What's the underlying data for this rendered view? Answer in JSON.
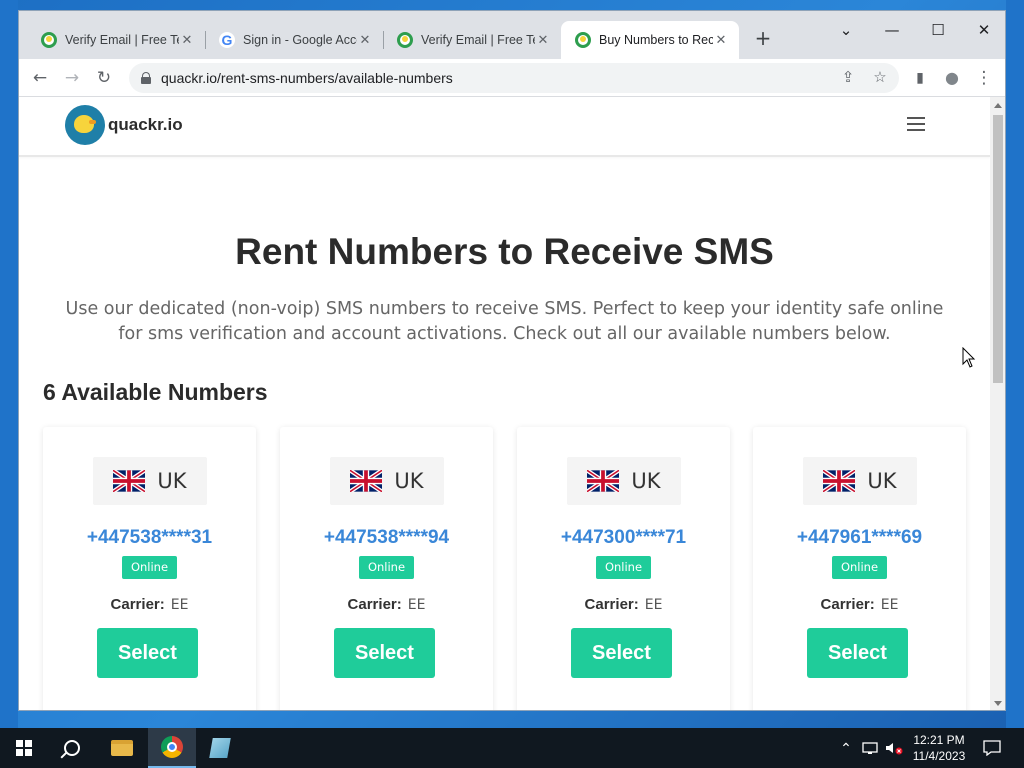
{
  "browser": {
    "tabs": [
      {
        "title": "Verify Email | Free Temporary",
        "favicon": "duck-favicon",
        "active": false
      },
      {
        "title": "Sign in - Google Accounts",
        "favicon": "google-favicon",
        "active": false
      },
      {
        "title": "Verify Email | Free Temporary",
        "favicon": "duck-favicon",
        "active": false
      },
      {
        "title": "Buy Numbers to Receive SMS",
        "favicon": "duck-favicon",
        "active": true
      }
    ],
    "new_tab_label": "+",
    "url": "quackr.io/rent-sms-numbers/available-numbers",
    "window_controls": {
      "dropdown": "⌄",
      "minimize": "—",
      "maximize": "☐",
      "close": "✕"
    },
    "nav": {
      "back": "←",
      "forward": "→",
      "reload": "↻"
    },
    "omnibox_icons": {
      "share": "⇪",
      "bookmark": "☆",
      "sidepanel": "▮",
      "profile": "●",
      "menu": "⋮"
    }
  },
  "site": {
    "logo_text": "quackr.io",
    "title": "Rent Numbers to Receive SMS",
    "subtitle": "Use our dedicated (non-voip) SMS numbers to receive SMS. Perfect to keep your identity safe online for sms verification and account activations. Check out all our available numbers below.",
    "available_heading": "6 Available Numbers",
    "cards": [
      {
        "country": "UK",
        "phone": "+447538****31",
        "status": "Online",
        "carrier_label": "Carrier:",
        "carrier": "EE",
        "button": "Select"
      },
      {
        "country": "UK",
        "phone": "+447538****94",
        "status": "Online",
        "carrier_label": "Carrier:",
        "carrier": "EE",
        "button": "Select"
      },
      {
        "country": "UK",
        "phone": "+447300****71",
        "status": "Online",
        "carrier_label": "Carrier:",
        "carrier": "EE",
        "button": "Select"
      },
      {
        "country": "UK",
        "phone": "+447961****69",
        "status": "Online",
        "carrier_label": "Carrier:",
        "carrier": "EE",
        "button": "Select"
      }
    ],
    "colors": {
      "accent": "#1fcc9a",
      "phone": "#3a87d8"
    }
  },
  "taskbar": {
    "time": "12:21 PM",
    "date": "11/4/2023"
  }
}
